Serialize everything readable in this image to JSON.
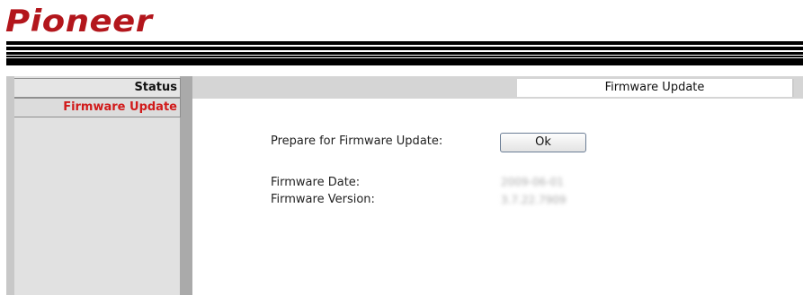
{
  "brand": {
    "logo_text": "Pioneer",
    "color": "#b3161c"
  },
  "sidebar": {
    "items": [
      {
        "label": "Status",
        "active": false
      },
      {
        "label": "Firmware Update",
        "active": true
      }
    ]
  },
  "tab": {
    "title": "Firmware Update"
  },
  "main": {
    "prepare_label": "Prepare for Firmware Update:",
    "ok_button_label": "Ok",
    "firmware_date_label": "Firmware Date:",
    "firmware_date_value": "2009-06-01",
    "firmware_version_label": "Firmware Version:",
    "firmware_version_value": "3.7.22.7909"
  }
}
